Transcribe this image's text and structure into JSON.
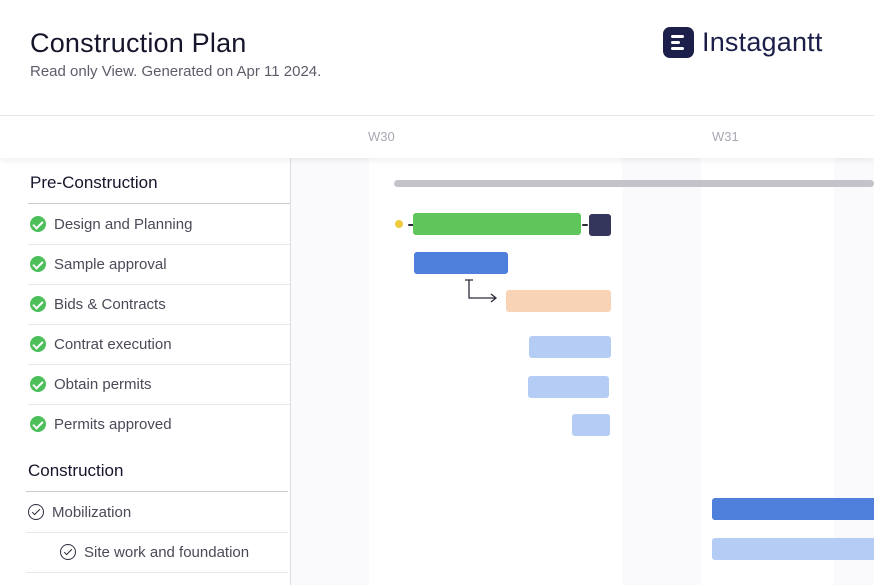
{
  "header": {
    "title": "Construction Plan",
    "subtitle": "Read only View. Generated on Apr 11 2024.",
    "logo_text": "Instagantt"
  },
  "timeline": {
    "weeks": [
      "W30",
      "W31"
    ]
  },
  "sidebar": {
    "sections": [
      {
        "title": "Pre-Construction",
        "tasks": [
          {
            "label": "Design and Planning",
            "status": "completed"
          },
          {
            "label": "Sample approval",
            "status": "completed"
          },
          {
            "label": "Bids & Contracts",
            "status": "completed"
          },
          {
            "label": "Contrat execution",
            "status": "completed"
          },
          {
            "label": "Obtain permits",
            "status": "completed"
          },
          {
            "label": "Permits approved",
            "status": "completed"
          }
        ]
      },
      {
        "title": "Construction",
        "tasks": [
          {
            "label": "Mobilization",
            "status": "open"
          },
          {
            "label": "Site work and foundation",
            "status": "open"
          }
        ]
      }
    ]
  },
  "colors": {
    "brand": "#1c1f4a",
    "done_green": "#4cbf5b",
    "bar_green": "#5ec65a",
    "bar_blue": "#4d7fdb",
    "bar_light_blue": "#b5cdf4",
    "bar_peach": "#f8d3b6",
    "summary_gray": "#c3c3c9",
    "milestone_navy": "#35365c",
    "dot_yellow": "#f0c93e"
  }
}
